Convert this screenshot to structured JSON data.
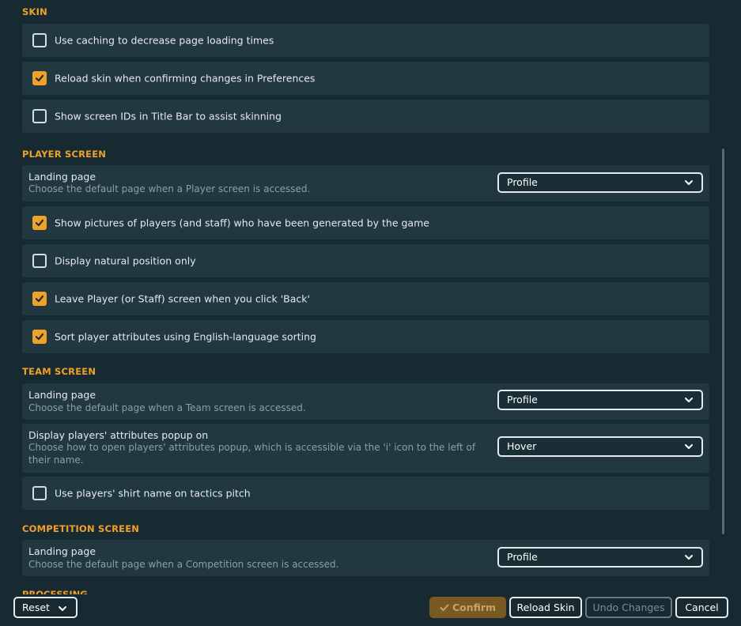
{
  "sections": {
    "skin": {
      "title": "SKIN",
      "options": [
        {
          "label": "Use caching to decrease page loading times",
          "checked": false
        },
        {
          "label": "Reload skin when confirming changes in Preferences",
          "checked": true
        },
        {
          "label": "Show screen IDs in Title Bar to assist skinning",
          "checked": false
        }
      ]
    },
    "player": {
      "title": "PLAYER SCREEN",
      "landing": {
        "title": "Landing page",
        "desc": "Choose the default page when a Player screen is accessed.",
        "value": "Profile"
      },
      "options": [
        {
          "label": "Show pictures of players (and staff) who have been generated by the game",
          "checked": true
        },
        {
          "label": "Display natural position only",
          "checked": false
        },
        {
          "label": "Leave Player (or Staff) screen when you click 'Back'",
          "checked": true
        },
        {
          "label": "Sort player attributes using English-language sorting",
          "checked": true
        }
      ]
    },
    "team": {
      "title": "TEAM SCREEN",
      "landing": {
        "title": "Landing page",
        "desc": "Choose the default page when a Team screen is accessed.",
        "value": "Profile"
      },
      "popup": {
        "title": "Display players' attributes popup on",
        "desc": "Choose how to open players' attributes popup, which is accessible via the 'i' icon to the left of their name.",
        "value": "Hover"
      },
      "options": [
        {
          "label": "Use players' shirt name on tactics pitch",
          "checked": false
        }
      ]
    },
    "competition": {
      "title": "COMPETITION SCREEN",
      "landing": {
        "title": "Landing page",
        "desc": "Choose the default page when a Competition screen is accessed.",
        "value": "Profile"
      }
    },
    "processing": {
      "title": "PROCESSING"
    }
  },
  "footer": {
    "reset": "Reset",
    "confirm": "Confirm",
    "reload_skin": "Reload Skin",
    "undo_changes": "Undo Changes",
    "cancel": "Cancel"
  },
  "colors": {
    "accent": "#f0a12a",
    "background": "#172a31",
    "row": "#213840"
  }
}
